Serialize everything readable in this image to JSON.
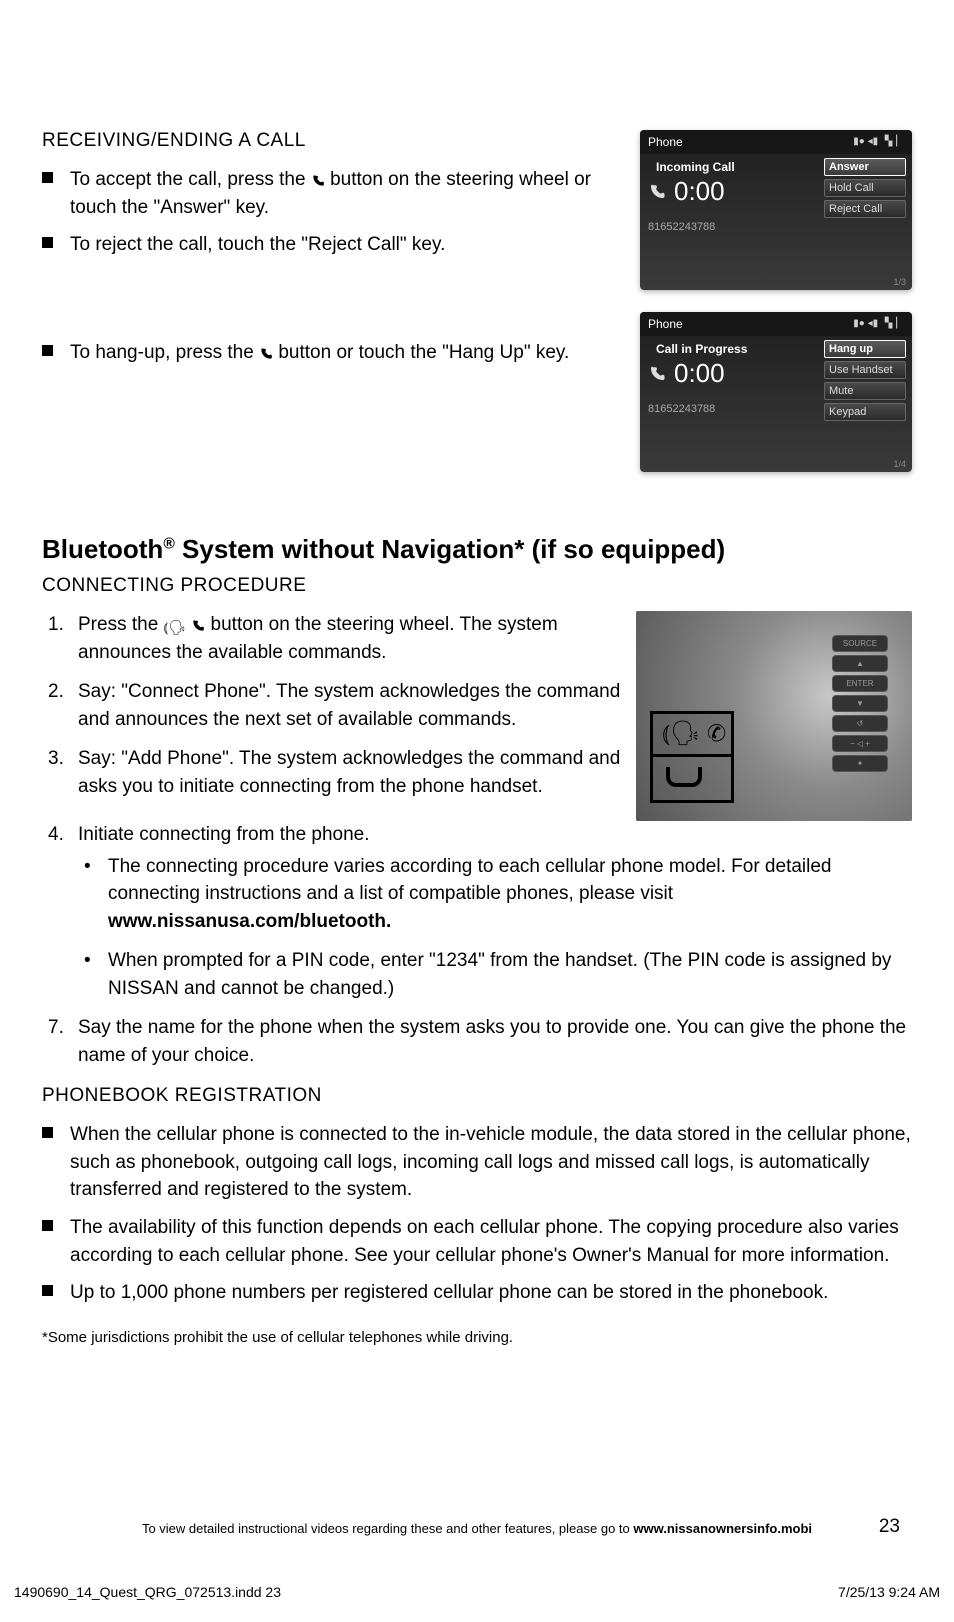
{
  "section1": {
    "heading": "RECEIVING/ENDING A CALL",
    "items": [
      {
        "pre": "To accept the call, press the ",
        "post": " button on the steering wheel or touch the \"Answer\" key."
      },
      {
        "pre": "To reject the call, touch the \"Reject Call\" key.",
        "post": ""
      },
      {
        "pre": "To hang-up, press the ",
        "post": " button or touch the \"Hang Up\" key."
      }
    ]
  },
  "phone_screens": {
    "title": "Phone",
    "incoming": {
      "status": "Incoming Call",
      "time": "0:00",
      "number": "81652243788",
      "buttons": [
        "Answer",
        "Hold Call",
        "Reject Call"
      ],
      "page": "1/3"
    },
    "inprogress": {
      "status": "Call in Progress",
      "time": "0:00",
      "number": "81652243788",
      "buttons": [
        "Hang up",
        "Use Handset",
        "Mute",
        "Keypad"
      ],
      "page": "1/4"
    }
  },
  "section2": {
    "title_pre": "Bluetooth",
    "title_sup": "®",
    "title_post": " System without Navigation* (if so equipped)",
    "heading": "CONNECTING PROCEDURE",
    "steps": [
      {
        "pre": "Press the ",
        "post": " button on the steering wheel. The system announces the available commands."
      },
      {
        "text": "Say: \"Connect Phone\". The system acknowledges the command and announces the next set of available commands."
      },
      {
        "text": "Say: \"Add Phone\". The system acknowledges the command and asks you to initiate connecting from the phone handset."
      },
      {
        "text": "Initiate connecting from the phone."
      },
      {
        "text": "Say the name for the phone when the system asks you to provide one. You can give the phone the name of your choice."
      }
    ],
    "sub_bullets": [
      {
        "pre": "The connecting procedure varies according to each cellular phone model. For detailed connecting instructions and a list of compatible phones, please visit ",
        "link": "www.nissanusa.com/bluetooth."
      },
      {
        "text": "When prompted for a PIN code, enter \"1234\" from the handset. (The PIN code is assigned by NISSAN and cannot be changed.)"
      }
    ],
    "steering_buttons": [
      "SOURCE",
      "▲",
      "ENTER",
      "▼",
      "↺",
      "− ◁ +",
      "✦"
    ]
  },
  "section3": {
    "heading": "PHONEBOOK REGISTRATION",
    "items": [
      "When the cellular phone is connected to the in-vehicle module, the data stored in the cellular phone, such as phonebook, outgoing call logs, incoming call logs and missed call logs, is automatically transferred and registered to the system.",
      "The availability of this function depends on each cellular phone. The copying procedure also varies according to each cellular phone. See your cellular phone's Owner's Manual for more information.",
      "Up to 1,000 phone numbers per registered cellular phone can be stored in the phonebook."
    ]
  },
  "footnote": "*Some jurisdictions prohibit the use of cellular telephones while driving.",
  "footer": {
    "text_pre": "To view detailed instructional videos regarding these and other features, please go to ",
    "text_link": "www.nissanownersinfo.mobi",
    "page": "23"
  },
  "indd": {
    "left": "1490690_14_Quest_QRG_072513.indd   23",
    "right": "7/25/13   9:24 AM"
  }
}
